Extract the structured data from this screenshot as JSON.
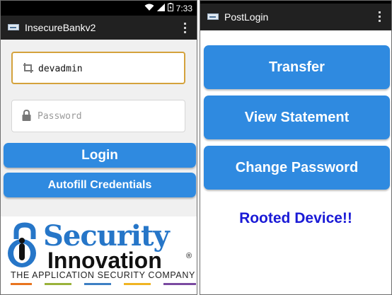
{
  "status_bar": {
    "time": "7:33",
    "icons": [
      "wifi-icon",
      "signal-icon",
      "battery-icon"
    ]
  },
  "login_screen": {
    "app_title": "InsecureBankv2",
    "username_value": "devadmin",
    "password_placeholder": "Password",
    "login_label": "Login",
    "autofill_label": "Autofill Credentials",
    "logo": {
      "line1": "Security",
      "line2": "Innovation",
      "tagline": "THE APPLICATION SECURITY COMPANY"
    }
  },
  "postlogin_screen": {
    "title": "PostLogin",
    "buttons": {
      "transfer": "Transfer",
      "view_statement": "View Statement",
      "change_password": "Change Password"
    },
    "status_message": "Rooted Device!!"
  },
  "colors": {
    "accent_blue": "#2f8ae0",
    "action_bar": "#212121",
    "focus_border": "#d4a23c",
    "rooted_text": "#1a1ad6",
    "logo_blue": "#2676c8"
  }
}
